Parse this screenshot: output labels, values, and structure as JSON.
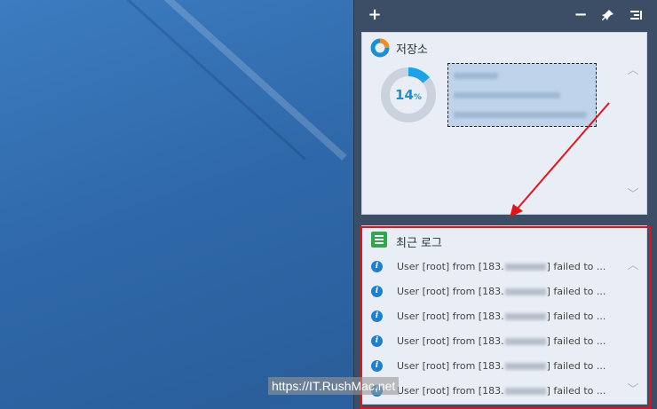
{
  "toolbar": {
    "add_icon": "plus-icon",
    "minimize_icon": "minus-icon",
    "pin_icon": "pin-icon",
    "menu_icon": "panel-menu-icon"
  },
  "storage_widget": {
    "title": "저장소",
    "usage_percent": 14,
    "usage_value": "14",
    "usage_unit": "%"
  },
  "log_widget": {
    "title": "최근 로그",
    "rows": [
      {
        "prefix": "User [root] from [183.",
        "suffix": "] failed to ..."
      },
      {
        "prefix": "User [root] from [183.",
        "suffix": "] failed to ..."
      },
      {
        "prefix": "User [root] from [183.",
        "suffix": "] failed to ..."
      },
      {
        "prefix": "User [root] from [183.",
        "suffix": "] failed to ..."
      },
      {
        "prefix": "User [root] from [183.",
        "suffix": "] failed to ..."
      },
      {
        "prefix": "User [root] from [183.",
        "suffix": "] failed to ..."
      }
    ]
  },
  "watermark": "https://IT.RushMac.net",
  "colors": {
    "accent": "#1b8fd6",
    "highlight": "#e2141b",
    "log_icon": "#2fa84a"
  }
}
